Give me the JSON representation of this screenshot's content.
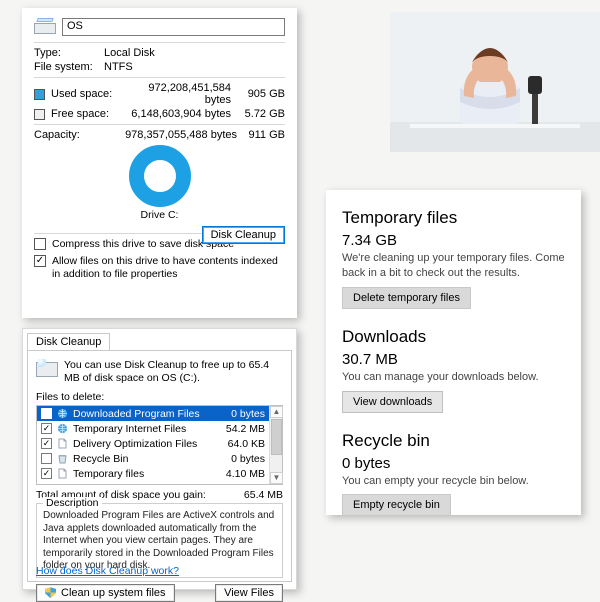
{
  "props": {
    "drive_name": "OS",
    "type_label": "Type:",
    "type_value": "Local Disk",
    "fs_label": "File system:",
    "fs_value": "NTFS",
    "used_label": "Used space:",
    "used_bytes": "972,208,451,584 bytes",
    "used_hum": "905 GB",
    "free_label": "Free space:",
    "free_bytes": "6,148,603,904 bytes",
    "free_hum": "5.72 GB",
    "cap_label": "Capacity:",
    "cap_bytes": "978,357,055,488 bytes",
    "cap_hum": "911 GB",
    "donut_label": "Drive C:",
    "cleanup_btn": "Disk Cleanup",
    "compress_label": "Compress this drive to save disk space",
    "index_label": "Allow files on this drive to have contents indexed in addition to file properties",
    "compress_checked": false,
    "index_checked": true
  },
  "cleanup": {
    "tab": "Disk Cleanup",
    "intro": "You can use Disk Cleanup to free up to 65.4 MB of disk space on OS (C:).",
    "files_to_delete": "Files to delete:",
    "items": [
      {
        "checked": true,
        "icon": "globe",
        "name": "Downloaded Program Files",
        "size": "0 bytes",
        "selected": true
      },
      {
        "checked": true,
        "icon": "globe",
        "name": "Temporary Internet Files",
        "size": "54.2 MB",
        "selected": false
      },
      {
        "checked": true,
        "icon": "file",
        "name": "Delivery Optimization Files",
        "size": "64.0 KB",
        "selected": false
      },
      {
        "checked": false,
        "icon": "bin",
        "name": "Recycle Bin",
        "size": "0 bytes",
        "selected": false
      },
      {
        "checked": true,
        "icon": "file",
        "name": "Temporary files",
        "size": "4.10 MB",
        "selected": false
      }
    ],
    "gain_label": "Total amount of disk space you gain:",
    "gain_value": "65.4 MB",
    "desc_legend": "Description",
    "desc_text": "Downloaded Program Files are ActiveX controls and Java applets downloaded automatically from the Internet when you view certain pages. They are temporarily stored in the Downloaded Program Files folder on your hard disk.",
    "clean_sys_btn": "Clean up system files",
    "view_files_btn": "View Files",
    "help_link": "How does Disk Cleanup work?"
  },
  "storage": {
    "temp_heading": "Temporary files",
    "temp_size": "7.34 GB",
    "temp_sub": "We're cleaning up your temporary files. Come back in a bit to check out the results.",
    "temp_btn": "Delete temporary files",
    "dl_heading": "Downloads",
    "dl_size": "30.7 MB",
    "dl_sub": "You can manage your downloads below.",
    "dl_btn": "View downloads",
    "rb_heading": "Recycle bin",
    "rb_size": "0 bytes",
    "rb_sub": "You can empty your recycle bin below.",
    "rb_btn": "Empty recycle bin"
  }
}
